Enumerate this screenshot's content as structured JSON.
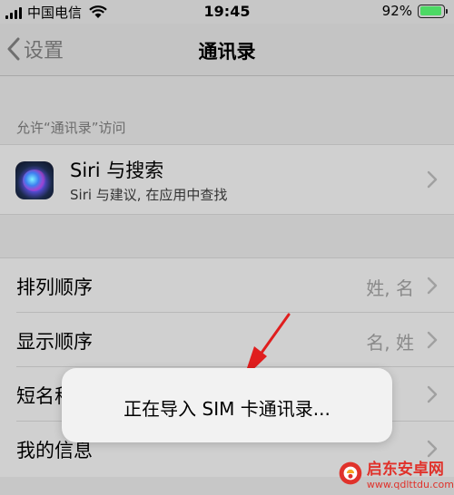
{
  "status_bar": {
    "carrier": "中国电信",
    "time": "19:45",
    "battery_percent": "92%",
    "battery_level": 0.92,
    "battery_color": "#4cd964",
    "signal_icon": "signal-bars-icon",
    "wifi_icon": "wifi-icon"
  },
  "nav": {
    "back_label": "设置",
    "title": "通讯录",
    "back_icon": "chevron-left-icon"
  },
  "section": {
    "header": "允许“通讯录”访问"
  },
  "siri": {
    "title": "Siri 与搜索",
    "subtitle": "Siri 与建议, 在应用中查找",
    "icon": "siri-icon"
  },
  "settings": {
    "items": [
      {
        "label": "排列顺序",
        "value": "姓, 名"
      },
      {
        "label": "显示顺序",
        "value": "名, 姓"
      },
      {
        "label": "短名称",
        "value": ""
      },
      {
        "label": "我的信息",
        "value": ""
      }
    ]
  },
  "toast": {
    "message": "正在导入 SIM 卡通讯录..."
  },
  "watermark": {
    "name": "启东安卓网",
    "url": "www.qdlttdu.com",
    "accent": "#e0322b"
  }
}
